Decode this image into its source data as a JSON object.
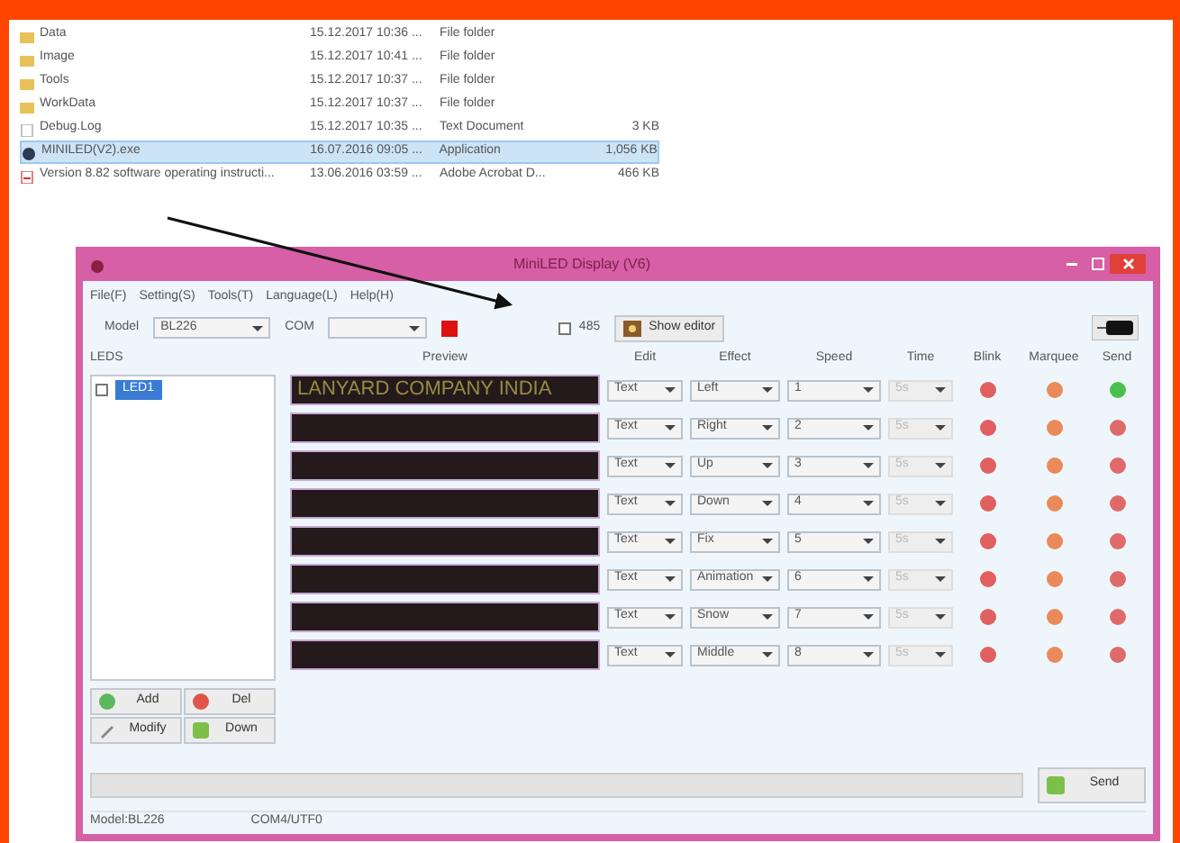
{
  "explorer": {
    "files": [
      {
        "kind": "folder",
        "name": "Data",
        "date": "15.12.2017 10:36 ...",
        "type": "File folder",
        "selected": false
      },
      {
        "kind": "folder",
        "name": "Image",
        "date": "15.12.2017 10:41 ...",
        "type": "File folder",
        "selected": false
      },
      {
        "kind": "folder",
        "name": "Tools",
        "date": "15.12.2017 10:37 ...",
        "type": "File folder",
        "selected": false
      },
      {
        "kind": "folder",
        "name": "WorkData",
        "date": "15.12.2017 10:37 ...",
        "type": "File folder",
        "selected": false
      },
      {
        "kind": "text",
        "name": "Debug.Log",
        "date": "15.12.2017 10:35 ...",
        "type": "Text Document",
        "size": "3 KB",
        "selected": false
      },
      {
        "kind": "app",
        "name": "MINILED(V2).exe",
        "date": "16.07.2016 09:05 ...",
        "type": "Application",
        "size": "1,056 KB",
        "selected": true
      },
      {
        "kind": "pdf",
        "name": "Version 8.82 software operating instructi...",
        "date": "13.06.2016 03:59 ...",
        "type": "Adobe Acrobat D...",
        "size": "466 KB",
        "selected": false
      }
    ]
  },
  "window": {
    "title": "MiniLED Display (V6)",
    "menu": [
      "File(F)",
      "Setting(S)",
      "Tools(T)",
      "Language(L)",
      "Help(H)"
    ],
    "model_label": "Model",
    "model_value": "BL226",
    "com_label": "COM",
    "rs485": {
      "label": "485",
      "checked": false
    },
    "show_editor": "Show editor",
    "leds_label": "LEDS",
    "tree": [
      {
        "label": "LED1",
        "checked": false,
        "selected": true
      }
    ],
    "columns": [
      "Preview",
      "Edit",
      "Effect",
      "Speed",
      "Time",
      "Blink",
      "Marquee",
      "Send"
    ],
    "rows": [
      {
        "preview": "LANYARD COMPANY INDIA",
        "edit": "Text",
        "effect": "Left",
        "speed": "1",
        "time": "5s",
        "time_enabled": false,
        "sent": true
      },
      {
        "preview": "",
        "edit": "Text",
        "effect": "Right",
        "speed": "2",
        "time": "5s",
        "time_enabled": false,
        "sent": false
      },
      {
        "preview": "",
        "edit": "Text",
        "effect": "Up",
        "speed": "3",
        "time": "5s",
        "time_enabled": false,
        "sent": false
      },
      {
        "preview": "",
        "edit": "Text",
        "effect": "Down",
        "speed": "4",
        "time": "5s",
        "time_enabled": false,
        "sent": false
      },
      {
        "preview": "",
        "edit": "Text",
        "effect": "Fix",
        "speed": "5",
        "time": "5s",
        "time_enabled": false,
        "sent": false
      },
      {
        "preview": "",
        "edit": "Text",
        "effect": "Animation",
        "speed": "6",
        "time": "5s",
        "time_enabled": false,
        "sent": false
      },
      {
        "preview": "",
        "edit": "Text",
        "effect": "Snow",
        "speed": "7",
        "time": "5s",
        "time_enabled": false,
        "sent": false
      },
      {
        "preview": "",
        "edit": "Text",
        "effect": "Middle",
        "speed": "8",
        "time": "5s",
        "time_enabled": false,
        "sent": false
      }
    ],
    "led_buttons": [
      {
        "kind": "add",
        "label": "Add"
      },
      {
        "kind": "del",
        "label": "Del"
      },
      {
        "kind": "modify",
        "label": "Modify"
      },
      {
        "kind": "down",
        "label": "Down"
      }
    ],
    "progress": {
      "level": 0
    },
    "send_button": "Send",
    "status_bar": [
      "Model:BL226",
      "COM4/UTF0"
    ]
  }
}
